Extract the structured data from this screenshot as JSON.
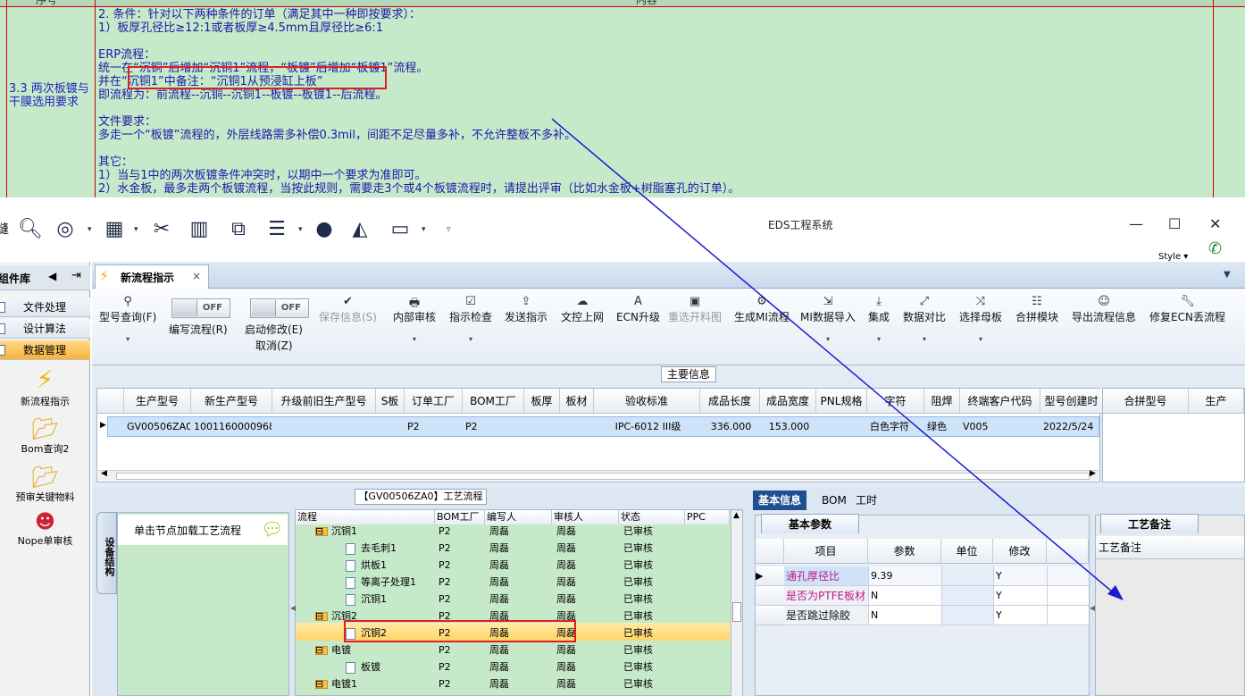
{
  "doc": {
    "top_left": "序号",
    "top_right": "内容",
    "left_cell": "3.3 两次板镀与干膜选用要求",
    "content_lines": [
      "2. 条件：针对以下两种条件的订单（满足其中一种即按要求）：",
      "1）板厚孔径比≥12:1或者板厚≥4.5mm且厚径比≥6:1",
      "",
      "ERP流程：",
      "统一在“沉铜”后增加“沉铜1”流程，“板镀”后增加“板镀1”流程。",
      "并在“沉铜1”中备注：“沉铜1从预浸缸上板”",
      "即流程为：前流程--沉铜--沉铜1--板镀--板镀1--后流程。",
      "",
      "文件要求：",
      "多走一个“板镀”流程的，外层线路需多补偿0.3mil，间距不足尽量多补，不允许整板不多补。",
      "",
      "其它：",
      "1）当与1中的两次板镀条件冲突时，以期中一个要求为准即可。",
      "2）水金板，最多走两个板镀流程，当按此规则，需要走3个或4个板镀流程时，请提出评审（比如水金板+树脂塞孔的订单）。"
    ]
  },
  "window": {
    "title": "EDS工程系统",
    "style_label": "Style",
    "controls": [
      "—",
      "☐",
      "✕"
    ]
  },
  "toolbar_icons": [
    "search-icon",
    "lifebuoy-icon",
    "grid-icon",
    "scissors-icon",
    "film-icon",
    "copy-icon",
    "list-icon",
    "user-icon",
    "chart-icon",
    "monitor-icon"
  ],
  "sidebar": {
    "header": "组件库",
    "items": [
      "文件处理",
      "设计算法",
      "数据管理"
    ],
    "shortcuts": [
      "新流程指示",
      "Bom查询2",
      "预审关键物料",
      "Nope单审核"
    ]
  },
  "tab": {
    "label": "新流程指示",
    "close": "×"
  },
  "ribbon": {
    "search": "型号查询(F)",
    "edit_flow": "编写流程(R)",
    "toggle_off": "OFF",
    "modify": "启动修改(E)",
    "cancel": "取消(Z)",
    "save": "保存信息(S)",
    "buttons": [
      "内部审核",
      "指示检查",
      "发送指示",
      "文控上网",
      "ECN升级",
      "重选开料图",
      "生成MI流程",
      "MI数据导入",
      "集成",
      "数据对比",
      "选择母板",
      "合拼模块",
      "导出流程信息",
      "修复ECN丢流程"
    ]
  },
  "main_info": {
    "title": "主要信息",
    "columns": [
      "生产型号",
      "新生产型号",
      "升级前旧生产型号",
      "S板",
      "订单工厂",
      "BOM工厂",
      "板厚",
      "板材",
      "验收标准",
      "成品长度",
      "成品宽度",
      "PNL规格",
      "字符",
      "阻焊",
      "终端客户代码",
      "型号创建时"
    ],
    "row": [
      "GV00506ZA0",
      "10011600009686",
      "",
      "",
      "P2",
      "P2",
      "",
      "",
      "IPC-6012 III级",
      "336.000",
      "153.000",
      "",
      "白色字符",
      "绿色",
      "V005",
      "2022/5/24"
    ],
    "right_columns": [
      "合拼型号",
      "生产"
    ]
  },
  "process": {
    "title": "【GV00506ZA0】工艺流程",
    "side_tab": "设备结构",
    "hint": "单击节点加载工艺流程",
    "columns": [
      "流程",
      "BOM工厂",
      "编写人",
      "审核人",
      "状态",
      "PPC"
    ],
    "rows": [
      {
        "name": "沉铜1",
        "type": "folder",
        "bom": "P2",
        "writer": "周磊",
        "reviewer": "周磊",
        "status": "已审核"
      },
      {
        "name": "去毛刺1",
        "type": "file",
        "bom": "P2",
        "writer": "周磊",
        "reviewer": "周磊",
        "status": "已审核"
      },
      {
        "name": "烘板1",
        "type": "file",
        "bom": "P2",
        "writer": "周磊",
        "reviewer": "周磊",
        "status": "已审核"
      },
      {
        "name": "等离子处理1",
        "type": "file",
        "bom": "P2",
        "writer": "周磊",
        "reviewer": "周磊",
        "status": "已审核"
      },
      {
        "name": "沉铜1",
        "type": "file",
        "bom": "P2",
        "writer": "周磊",
        "reviewer": "周磊",
        "status": "已审核"
      },
      {
        "name": "沉铜2",
        "type": "folder",
        "bom": "P2",
        "writer": "周磊",
        "reviewer": "周磊",
        "status": "已审核"
      },
      {
        "name": "沉铜2",
        "type": "file",
        "bom": "P2",
        "writer": "周磊",
        "reviewer": "周磊",
        "status": "已审核"
      },
      {
        "name": "电镀",
        "type": "folder",
        "bom": "P2",
        "writer": "周磊",
        "reviewer": "周磊",
        "status": "已审核"
      },
      {
        "name": "板镀",
        "type": "file",
        "bom": "P2",
        "writer": "周磊",
        "reviewer": "周磊",
        "status": "已审核"
      },
      {
        "name": "电镀1",
        "type": "folder",
        "bom": "P2",
        "writer": "周磊",
        "reviewer": "周磊",
        "status": "已审核"
      }
    ]
  },
  "info_panel": {
    "tabs": [
      "基本信息",
      "BOM",
      "工时"
    ],
    "basic_params": "基本参数",
    "columns": [
      "项目",
      "参数",
      "单位",
      "修改"
    ],
    "rows": [
      {
        "item": "通孔厚径比",
        "value": "9.39",
        "unit": "",
        "modify": "Y"
      },
      {
        "item": "是否为PTFE板材",
        "value": "N",
        "unit": "",
        "modify": "Y"
      },
      {
        "item": "是否跳过除胶",
        "value": "N",
        "unit": "",
        "modify": "Y"
      }
    ],
    "process_note_tab": "工艺备注",
    "process_note_header": "工艺备注"
  }
}
